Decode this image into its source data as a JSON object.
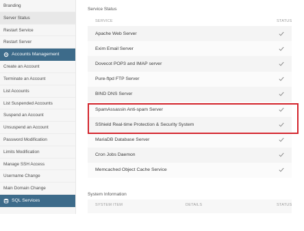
{
  "sidebar": {
    "items_top": [
      {
        "label": "Branding",
        "active": false
      },
      {
        "label": "Server Status",
        "active": true
      },
      {
        "label": "Restart Service",
        "active": false
      },
      {
        "label": "Restart Server",
        "active": false
      }
    ],
    "accounts_header": {
      "label": "Accounts Management",
      "icon": "settings-icon"
    },
    "account_items": [
      "Create an Account",
      "Terminate an Account",
      "List Accounts",
      "List Suspended Accounts",
      "Suspend an Account",
      "Unsuspend an Account",
      "Password Modification",
      "Limits Modification",
      "Manage SSH Access",
      "Username Change",
      "Main Domain Change"
    ],
    "sql_header": {
      "label": "SQL Services",
      "icon": "database-icon"
    }
  },
  "service_status": {
    "title": "Service Status",
    "col_service": "SERVICE",
    "col_status": "STATUS",
    "rows": [
      "Apache Web Server",
      "Exim Email Server",
      "Dovecot POP3 and IMAP server",
      "Pure-ftpd FTP Server",
      "BIND DNS Server",
      "SpamAssassin Anti-spam Server",
      "SShield Real-time Protection & Security System",
      "MariaDB Database Server",
      "Cron Jobs Daemon",
      "Memcached Object Cache Service"
    ],
    "status_icon": "check-icon",
    "highlight_color": "#d3222a"
  },
  "system_information": {
    "title": "System Information",
    "col_item": "SYSTEM ITEM",
    "col_details": "DETAILS",
    "col_status": "STATUS"
  },
  "colors": {
    "header_bg": "#3d6b8a",
    "sidebar_bg": "#f6f6f6"
  }
}
